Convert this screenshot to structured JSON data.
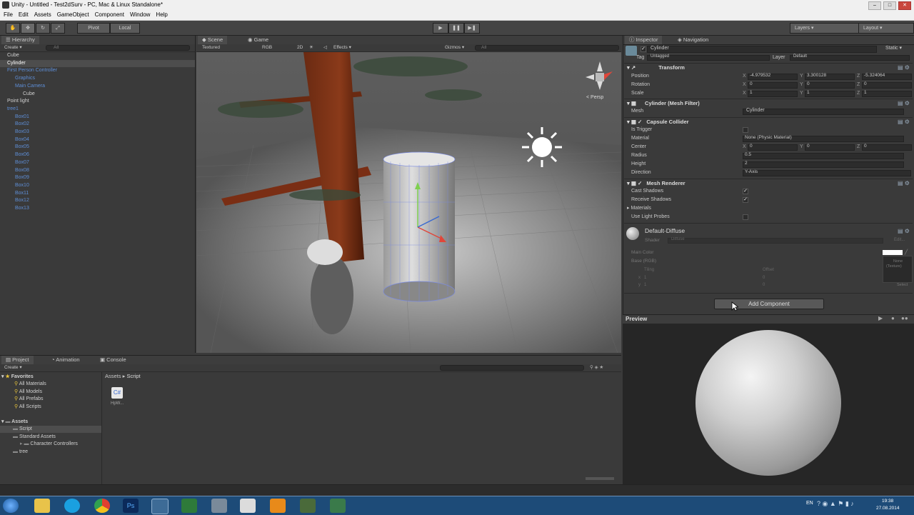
{
  "window": {
    "title": "Unity - Untitled - Test2dSurv - PC, Mac & Linux Standalone*"
  },
  "menu": [
    "File",
    "Edit",
    "Assets",
    "GameObject",
    "Component",
    "Window",
    "Help"
  ],
  "toolbar": {
    "pivot": "Pivot",
    "local": "Local",
    "layers": "Layers",
    "layout": "Layout"
  },
  "hierarchy": {
    "tab": "Hierarchy",
    "create": "Create",
    "search": "All",
    "items": [
      {
        "label": "Cube",
        "indent": 0,
        "blue": false,
        "selected": false
      },
      {
        "label": "Cylinder",
        "indent": 0,
        "blue": false,
        "selected": true
      },
      {
        "label": "First Person Controller",
        "indent": 0,
        "blue": true,
        "selected": false
      },
      {
        "label": "Graphics",
        "indent": 1,
        "blue": true,
        "selected": false
      },
      {
        "label": "Main Camera",
        "indent": 1,
        "blue": true,
        "selected": false
      },
      {
        "label": "Cube",
        "indent": 2,
        "blue": false,
        "selected": false
      },
      {
        "label": "Point light",
        "indent": 0,
        "blue": false,
        "selected": false
      },
      {
        "label": "tree1",
        "indent": 0,
        "blue": true,
        "selected": false
      },
      {
        "label": "Box01",
        "indent": 1,
        "blue": true,
        "selected": false
      },
      {
        "label": "Box02",
        "indent": 1,
        "blue": true,
        "selected": false
      },
      {
        "label": "Box03",
        "indent": 1,
        "blue": true,
        "selected": false
      },
      {
        "label": "Box04",
        "indent": 1,
        "blue": true,
        "selected": false
      },
      {
        "label": "Box05",
        "indent": 1,
        "blue": true,
        "selected": false
      },
      {
        "label": "Box06",
        "indent": 1,
        "blue": true,
        "selected": false
      },
      {
        "label": "Box07",
        "indent": 1,
        "blue": true,
        "selected": false
      },
      {
        "label": "Box08",
        "indent": 1,
        "blue": true,
        "selected": false
      },
      {
        "label": "Box09",
        "indent": 1,
        "blue": true,
        "selected": false
      },
      {
        "label": "Box10",
        "indent": 1,
        "blue": true,
        "selected": false
      },
      {
        "label": "Box11",
        "indent": 1,
        "blue": true,
        "selected": false
      },
      {
        "label": "Box12",
        "indent": 1,
        "blue": true,
        "selected": false
      },
      {
        "label": "Box13",
        "indent": 1,
        "blue": true,
        "selected": false
      }
    ]
  },
  "scene": {
    "tab_scene": "Scene",
    "tab_game": "Game",
    "shading": "Textured",
    "render": "RGB",
    "mode_2d": "2D",
    "effects": "Effects",
    "gizmos": "Gizmos",
    "search": "All",
    "persp": "< Persp"
  },
  "inspector": {
    "tab": "Inspector",
    "tab_nav": "Navigation",
    "object_name": "Cylinder",
    "static": "Static",
    "tag_label": "Tag",
    "tag_value": "Untagged",
    "layer_label": "Layer",
    "layer_value": "Default",
    "transform": {
      "title": "Transform",
      "position": {
        "label": "Position",
        "x": "-4.979532",
        "y": "3.300128",
        "z": "-5.324064"
      },
      "rotation": {
        "label": "Rotation",
        "x": "0",
        "y": "0",
        "z": "0"
      },
      "scale": {
        "label": "Scale",
        "x": "1",
        "y": "1",
        "z": "1"
      }
    },
    "mesh_filter": {
      "title": "Cylinder (Mesh Filter)",
      "mesh_label": "Mesh",
      "mesh_value": "Cylinder"
    },
    "capsule": {
      "title": "Capsule Collider",
      "is_trigger": "Is Trigger",
      "material_label": "Material",
      "material_value": "None (Physic Material)",
      "center_label": "Center",
      "cx": "0",
      "cy": "0",
      "cz": "0",
      "radius_label": "Radius",
      "radius_value": "0.5",
      "height_label": "Height",
      "height_value": "2",
      "direction_label": "Direction",
      "direction_value": "Y-Axis"
    },
    "renderer": {
      "title": "Mesh Renderer",
      "cast": "Cast Shadows",
      "receive": "Receive Shadows",
      "materials": "Materials",
      "probes": "Use Light Probes"
    },
    "material": {
      "name": "Default-Diffuse",
      "shader_label": "Shader",
      "shader_value": "Diffuse",
      "main_color": "Main Color",
      "base": "Base (RGB)",
      "tiling": "Tiling",
      "offset": "Offset",
      "x": "x",
      "y": "y",
      "t1": "1",
      "t2": "1",
      "o1": "0",
      "o2": "0",
      "none": "None",
      "texture": "(Texture)",
      "select": "Select",
      "edit": "Edit..."
    },
    "add_component": "Add Component",
    "preview": "Preview"
  },
  "project": {
    "tab_project": "Project",
    "tab_anim": "Animation",
    "tab_console": "Console",
    "create": "Create",
    "favorites": "Favorites",
    "fav_items": [
      "All Materials",
      "All Models",
      "All Prefabs",
      "All Scripts"
    ],
    "assets": "Assets",
    "asset_items": [
      {
        "label": "Script",
        "indent": 1,
        "selected": true
      },
      {
        "label": "Standard Assets",
        "indent": 1,
        "selected": false
      },
      {
        "label": "Character Controllers",
        "indent": 2,
        "selected": false
      },
      {
        "label": "tree",
        "indent": 1,
        "selected": false
      }
    ],
    "breadcrumb_root": "Assets",
    "breadcrumb_sep": "▸",
    "breadcrumb_leaf": "Script",
    "file_name": "HpW..."
  },
  "taskbar": {
    "lang": "EN",
    "time": "19:38",
    "date": "27.08.2014"
  },
  "colors": {
    "selected": "#4d4d4d",
    "blue_text": "#5e8ed6",
    "taskbar": "#1d4b78"
  }
}
